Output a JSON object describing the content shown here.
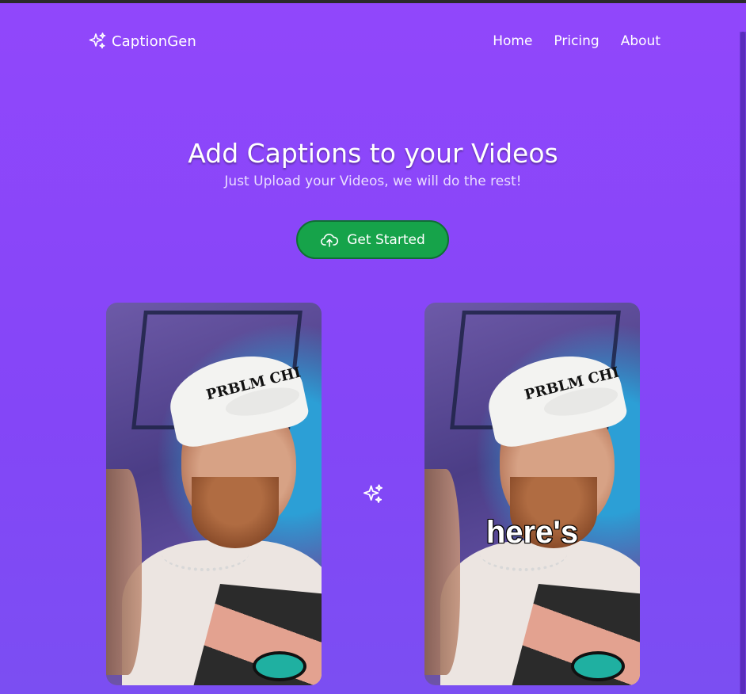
{
  "brand": {
    "name": "CaptionGen",
    "icon": "sparkles-icon"
  },
  "nav": {
    "links": [
      {
        "label": "Home"
      },
      {
        "label": "Pricing"
      },
      {
        "label": "About"
      }
    ]
  },
  "hero": {
    "title": "Add Captions to your Videos",
    "subtitle": "Just Upload your Videos, we will do the rest!",
    "cta_label": "Get Started",
    "cta_icon": "cloud-upload-icon"
  },
  "demo": {
    "before_icon": "sparkles-icon",
    "caption_word": "here's",
    "cap_text": "PRBLM CHI"
  },
  "colors": {
    "background": "#9147fb",
    "cta": "#16a34a",
    "cta_border": "#0f6f34"
  }
}
